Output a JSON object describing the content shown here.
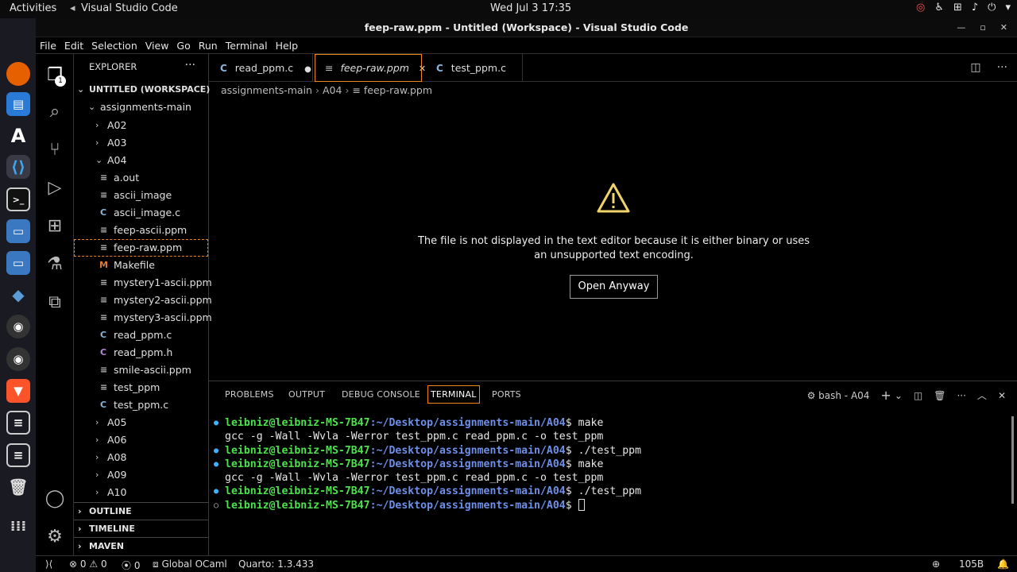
{
  "gnome": {
    "activities": "Activities",
    "app_name": "Visual Studio Code",
    "clock": "Wed Jul 3  17:35"
  },
  "window": {
    "title": "feep-raw.ppm - Untitled (Workspace) - Visual Studio Code"
  },
  "menu": [
    "File",
    "Edit",
    "Selection",
    "View",
    "Go",
    "Run",
    "Terminal",
    "Help"
  ],
  "activity": {
    "explorer_badge": "1"
  },
  "explorer": {
    "header": "EXPLORER",
    "more": "···",
    "workspace": "UNTITLED (WORKSPACE)",
    "root_folder": "assignments-main",
    "folders_before": [
      "A02",
      "A03"
    ],
    "open_folder": "A04",
    "files": [
      {
        "name": "a.out",
        "icon": "≡"
      },
      {
        "name": "ascii_image",
        "icon": "≡"
      },
      {
        "name": "ascii_image.c",
        "icon": "C"
      },
      {
        "name": "feep-ascii.ppm",
        "icon": "≡"
      },
      {
        "name": "feep-raw.ppm",
        "icon": "≡"
      },
      {
        "name": "Makefile",
        "icon": "M"
      },
      {
        "name": "mystery1-ascii.ppm",
        "icon": "≡"
      },
      {
        "name": "mystery2-ascii.ppm",
        "icon": "≡"
      },
      {
        "name": "mystery3-ascii.ppm",
        "icon": "≡"
      },
      {
        "name": "read_ppm.c",
        "icon": "C"
      },
      {
        "name": "read_ppm.h",
        "icon": "C"
      },
      {
        "name": "smile-ascii.ppm",
        "icon": "≡"
      },
      {
        "name": "test_ppm",
        "icon": "≡"
      },
      {
        "name": "test_ppm.c",
        "icon": "C"
      }
    ],
    "folders_after": [
      "A05",
      "A06",
      "A08",
      "A09",
      "A10"
    ],
    "sections": [
      "OUTLINE",
      "TIMELINE",
      "MAVEN"
    ]
  },
  "tabs": [
    {
      "label": "read_ppm.c",
      "icon": "C",
      "modified": "●"
    },
    {
      "label": "feep-raw.ppm",
      "icon": "≡",
      "close": "✕"
    },
    {
      "label": "test_ppm.c",
      "icon": "C"
    }
  ],
  "breadcrumb": [
    "assignments-main",
    "A04",
    "feep-raw.ppm"
  ],
  "editor": {
    "warning_icon": "⚠",
    "message": "The file is not displayed in the text editor because it is either binary or uses an unsupported text encoding.",
    "button": "Open Anyway"
  },
  "panel": {
    "tabs": [
      "PROBLEMS",
      "OUTPUT",
      "DEBUG CONSOLE",
      "TERMINAL",
      "PORTS"
    ],
    "active_tab": "TERMINAL",
    "terminal_name": "bash - A04"
  },
  "terminal": {
    "user_host": "leibniz@leibniz-MS-7B47",
    "path": ":~/Desktop/assignments-main/A04",
    "lines": [
      {
        "type": "prompt",
        "cmd": "$ make"
      },
      {
        "type": "output",
        "text": "gcc -g -Wall -Wvla -Werror test_ppm.c read_ppm.c -o test_ppm"
      },
      {
        "type": "prompt",
        "cmd": "$ ./test_ppm"
      },
      {
        "type": "prompt",
        "cmd": "$ make"
      },
      {
        "type": "output",
        "text": "gcc -g -Wall -Wvla -Werror test_ppm.c read_ppm.c -o test_ppm"
      },
      {
        "type": "prompt",
        "cmd": "$ ./test_ppm"
      },
      {
        "type": "prompt",
        "cmd": "$ "
      }
    ]
  },
  "status": {
    "errors": "0",
    "warnings": "0",
    "ports": "0",
    "ocaml": "Global OCaml",
    "quarto": "Quarto: 1.3.433",
    "right": "105B"
  }
}
